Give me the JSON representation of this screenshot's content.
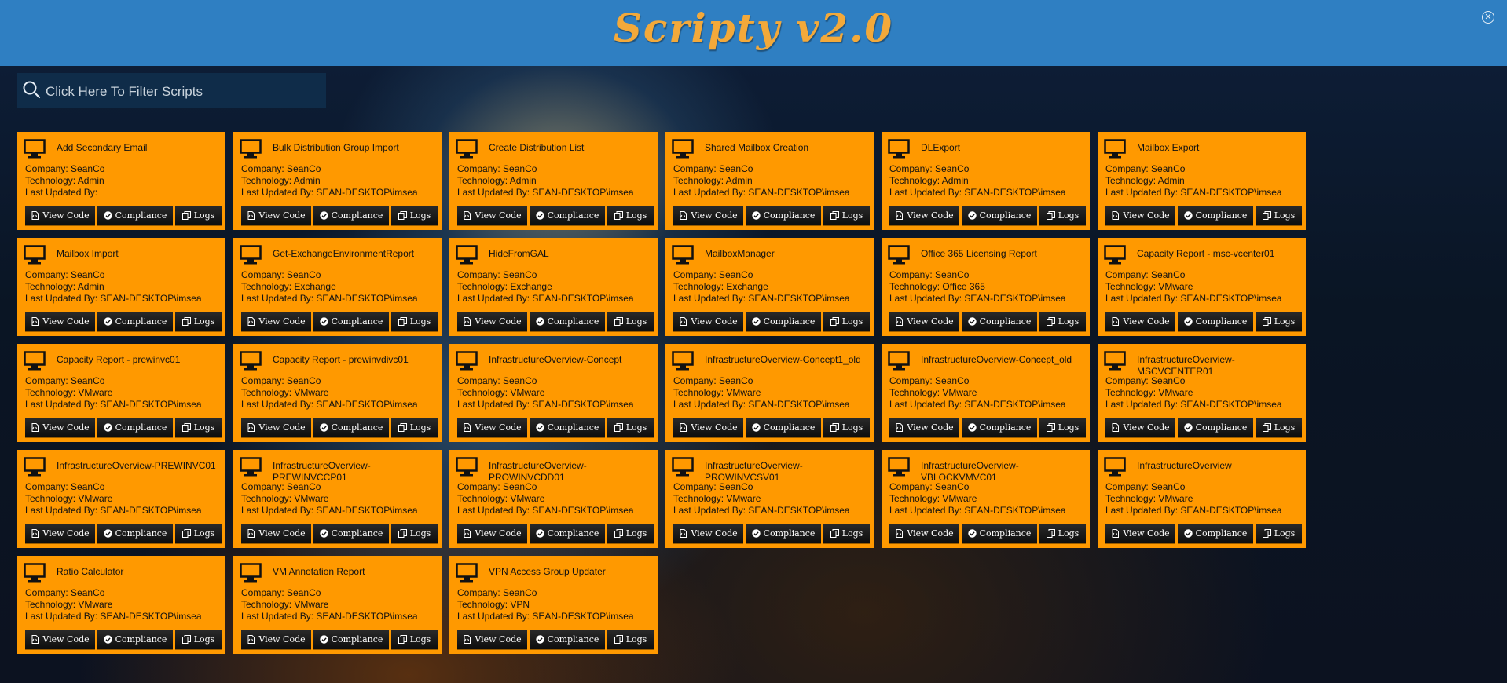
{
  "header": {
    "title": "Scripty v2.0"
  },
  "window": {
    "close_icon": "close-circle-icon"
  },
  "filter": {
    "placeholder": "Click Here To Filter Scripts",
    "icon": "search-icon"
  },
  "labels": {
    "company": "Company:",
    "technology": "Technology:",
    "last_updated": "Last Updated By:"
  },
  "buttons": {
    "view_code": "View Code",
    "compliance": "Compliance",
    "logs": "Logs"
  },
  "colors": {
    "header": "#2f7fc2",
    "brand": "#f3a93a",
    "card": "#ff9900",
    "button": "#111111"
  },
  "scripts": [
    {
      "name": "Add Secondary Email",
      "company": "SeanCo",
      "technology": "Admin",
      "updated_by": ""
    },
    {
      "name": "Bulk Distribution Group Import",
      "company": "SeanCo",
      "technology": "Admin",
      "updated_by": "SEAN-DESKTOP\\imsea"
    },
    {
      "name": "Create Distribution List",
      "company": "SeanCo",
      "technology": "Admin",
      "updated_by": "SEAN-DESKTOP\\imsea"
    },
    {
      "name": "Shared Mailbox Creation",
      "company": "SeanCo",
      "technology": "Admin",
      "updated_by": "SEAN-DESKTOP\\imsea"
    },
    {
      "name": "DLExport",
      "company": "SeanCo",
      "technology": "Admin",
      "updated_by": "SEAN-DESKTOP\\imsea"
    },
    {
      "name": "Mailbox Export",
      "company": "SeanCo",
      "technology": "Admin",
      "updated_by": "SEAN-DESKTOP\\imsea"
    },
    {
      "name": "Mailbox Import",
      "company": "SeanCo",
      "technology": "Admin",
      "updated_by": "SEAN-DESKTOP\\imsea"
    },
    {
      "name": "Get-ExchangeEnvironmentReport",
      "company": "SeanCo",
      "technology": "Exchange",
      "updated_by": "SEAN-DESKTOP\\imsea"
    },
    {
      "name": "HideFromGAL",
      "company": "SeanCo",
      "technology": "Exchange",
      "updated_by": "SEAN-DESKTOP\\imsea"
    },
    {
      "name": "MailboxManager",
      "company": "SeanCo",
      "technology": "Exchange",
      "updated_by": "SEAN-DESKTOP\\imsea"
    },
    {
      "name": "Office 365 Licensing Report",
      "company": "SeanCo",
      "technology": "Office 365",
      "updated_by": "SEAN-DESKTOP\\imsea"
    },
    {
      "name": "Capacity Report - msc-vcenter01",
      "company": "SeanCo",
      "technology": "VMware",
      "updated_by": "SEAN-DESKTOP\\imsea"
    },
    {
      "name": "Capacity Report - prewinvc01",
      "company": "SeanCo",
      "technology": "VMware",
      "updated_by": "SEAN-DESKTOP\\imsea"
    },
    {
      "name": "Capacity Report - prewinvdivc01",
      "company": "SeanCo",
      "technology": "VMware",
      "updated_by": "SEAN-DESKTOP\\imsea"
    },
    {
      "name": "InfrastructureOverview-Concept",
      "company": "SeanCo",
      "technology": "VMware",
      "updated_by": "SEAN-DESKTOP\\imsea"
    },
    {
      "name": "InfrastructureOverview-Concept1_old",
      "company": "SeanCo",
      "technology": "VMware",
      "updated_by": "SEAN-DESKTOP\\imsea"
    },
    {
      "name": "InfrastructureOverview-Concept_old",
      "company": "SeanCo",
      "technology": "VMware",
      "updated_by": "SEAN-DESKTOP\\imsea"
    },
    {
      "name": "InfrastructureOverview-MSCVCENTER01",
      "company": "SeanCo",
      "technology": "VMware",
      "updated_by": "SEAN-DESKTOP\\imsea"
    },
    {
      "name": "InfrastructureOverview-PREWINVC01",
      "company": "SeanCo",
      "technology": "VMware",
      "updated_by": "SEAN-DESKTOP\\imsea"
    },
    {
      "name": "InfrastructureOverview-PREWINVCCP01",
      "company": "SeanCo",
      "technology": "VMware",
      "updated_by": "SEAN-DESKTOP\\imsea"
    },
    {
      "name": "InfrastructureOverview-PROWINVCDD01",
      "company": "SeanCo",
      "technology": "VMware",
      "updated_by": "SEAN-DESKTOP\\imsea"
    },
    {
      "name": "InfrastructureOverview-PROWINVCSV01",
      "company": "SeanCo",
      "technology": "VMware",
      "updated_by": "SEAN-DESKTOP\\imsea"
    },
    {
      "name": "InfrastructureOverview-VBLOCKVMVC01",
      "company": "SeanCo",
      "technology": "VMware",
      "updated_by": "SEAN-DESKTOP\\imsea"
    },
    {
      "name": "InfrastructureOverview",
      "company": "SeanCo",
      "technology": "VMware",
      "updated_by": "SEAN-DESKTOP\\imsea"
    },
    {
      "name": "Ratio Calculator",
      "company": "SeanCo",
      "technology": "VMware",
      "updated_by": "SEAN-DESKTOP\\imsea"
    },
    {
      "name": "VM Annotation Report",
      "company": "SeanCo",
      "technology": "VMware",
      "updated_by": "SEAN-DESKTOP\\imsea"
    },
    {
      "name": "VPN Access Group Updater",
      "company": "SeanCo",
      "technology": "VPN",
      "updated_by": "SEAN-DESKTOP\\imsea"
    }
  ]
}
